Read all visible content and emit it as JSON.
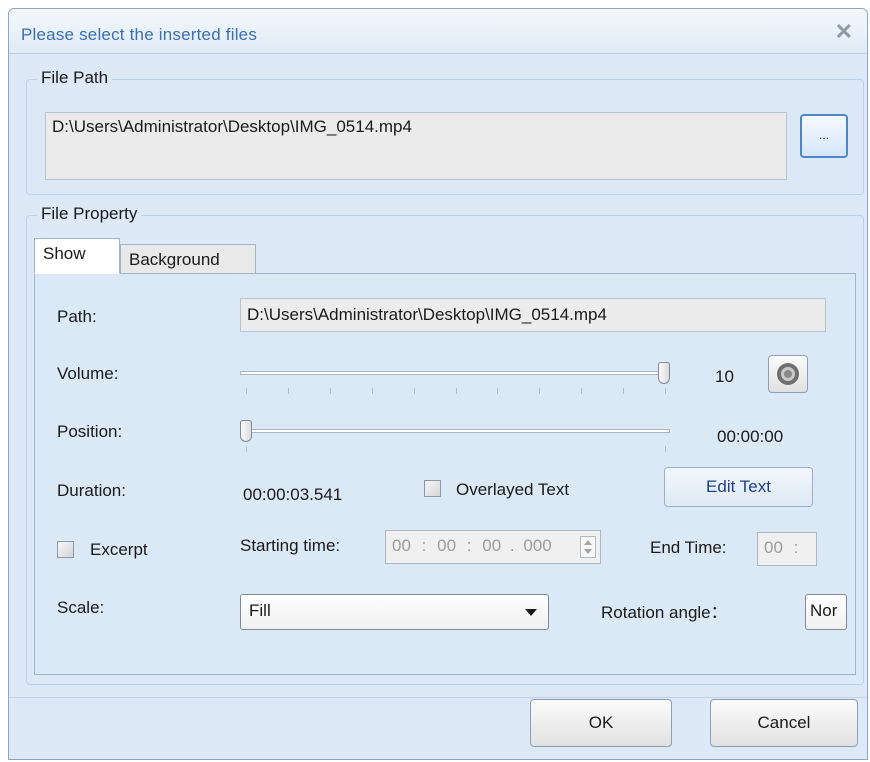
{
  "dialog": {
    "title": "Please select the inserted files",
    "close_icon": "x-close-icon"
  },
  "file_path": {
    "legend": "File Path",
    "value": "D:\\Users\\Administrator\\Desktop\\IMG_0514.mp4",
    "browse_label": "..."
  },
  "file_property": {
    "legend": "File Property",
    "tabs": [
      {
        "label": "Show",
        "active": true
      },
      {
        "label": "Background",
        "active": false
      }
    ],
    "path_label": "Path:",
    "path_value": "D:\\Users\\Administrator\\Desktop\\IMG_0514.mp4",
    "volume_label": "Volume:",
    "volume_value": "10",
    "volume_level": 1.0,
    "speaker_icon": "speaker-icon",
    "position_label": "Position:",
    "position_value": "00:00:00",
    "position_level": 0.0,
    "duration_label": "Duration:",
    "duration_value": "00:00:03.541",
    "overlayed_text_label": "Overlayed Text",
    "overlayed_text_checked": false,
    "edit_text_label": "Edit Text",
    "excerpt_label": "Excerpt",
    "excerpt_checked": false,
    "starting_time_label": "Starting time:",
    "starting_time": {
      "hh": "00",
      "mm": "00",
      "ss": "00",
      "ms": "000"
    },
    "end_time_label": "End Time:",
    "end_time_visible": "00",
    "scale_label": "Scale:",
    "scale_value": "Fill",
    "rotation_label": "Rotation angle：",
    "rotation_value": "Nor"
  },
  "buttons": {
    "ok": "OK",
    "cancel": "Cancel"
  },
  "colors": {
    "dialog_bg": "#dde9f6",
    "title_text": "#3a6fb2",
    "edit_text_label": "#1f3f8c"
  }
}
